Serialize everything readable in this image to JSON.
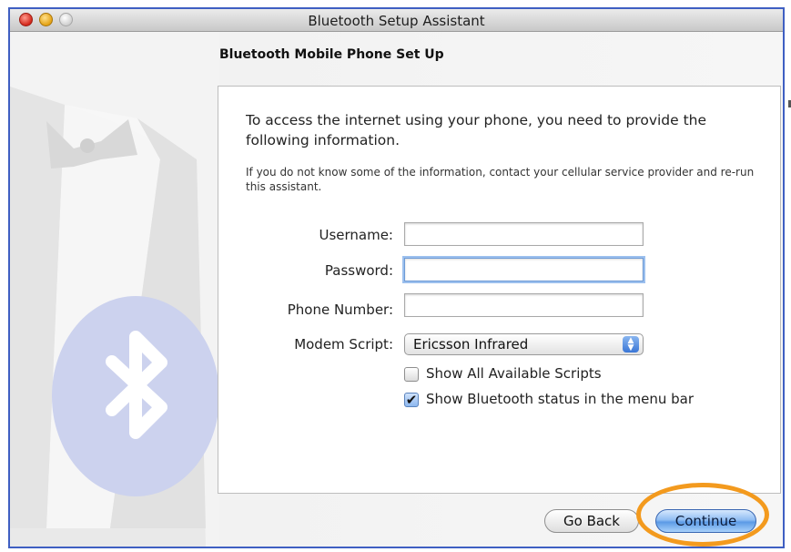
{
  "window": {
    "title": "Bluetooth Setup Assistant"
  },
  "section_title": "Bluetooth Mobile Phone Set Up",
  "intro_text": "To access the internet using your phone, you need to provide the following information.",
  "note_text": "If you do not know some of the information, contact your cellular service provider and re-run this assistant.",
  "form": {
    "username_label": "Username:",
    "username_value": "",
    "password_label": "Password:",
    "password_value": "",
    "phone_label": "Phone Number:",
    "phone_value": "",
    "modem_label": "Modem Script:",
    "modem_selected": "Ericsson Infrared",
    "show_all_scripts_label": "Show All Available Scripts",
    "show_all_scripts_checked": false,
    "show_status_label": "Show Bluetooth status in the menu bar",
    "show_status_checked": true
  },
  "buttons": {
    "back_label": "Go Back",
    "continue_label": "Continue"
  },
  "icons": {
    "window_controls": [
      "close-icon",
      "minimize-icon",
      "zoom-icon"
    ],
    "background_art": "bluetooth-logo-icon",
    "select_arrows": "updown-arrows-icon",
    "checkmark": "checkmark-icon"
  },
  "colors": {
    "window_border": "#3f5fc2",
    "highlight_ring": "#f39a1e",
    "primary_button": "#5c9ae6"
  }
}
